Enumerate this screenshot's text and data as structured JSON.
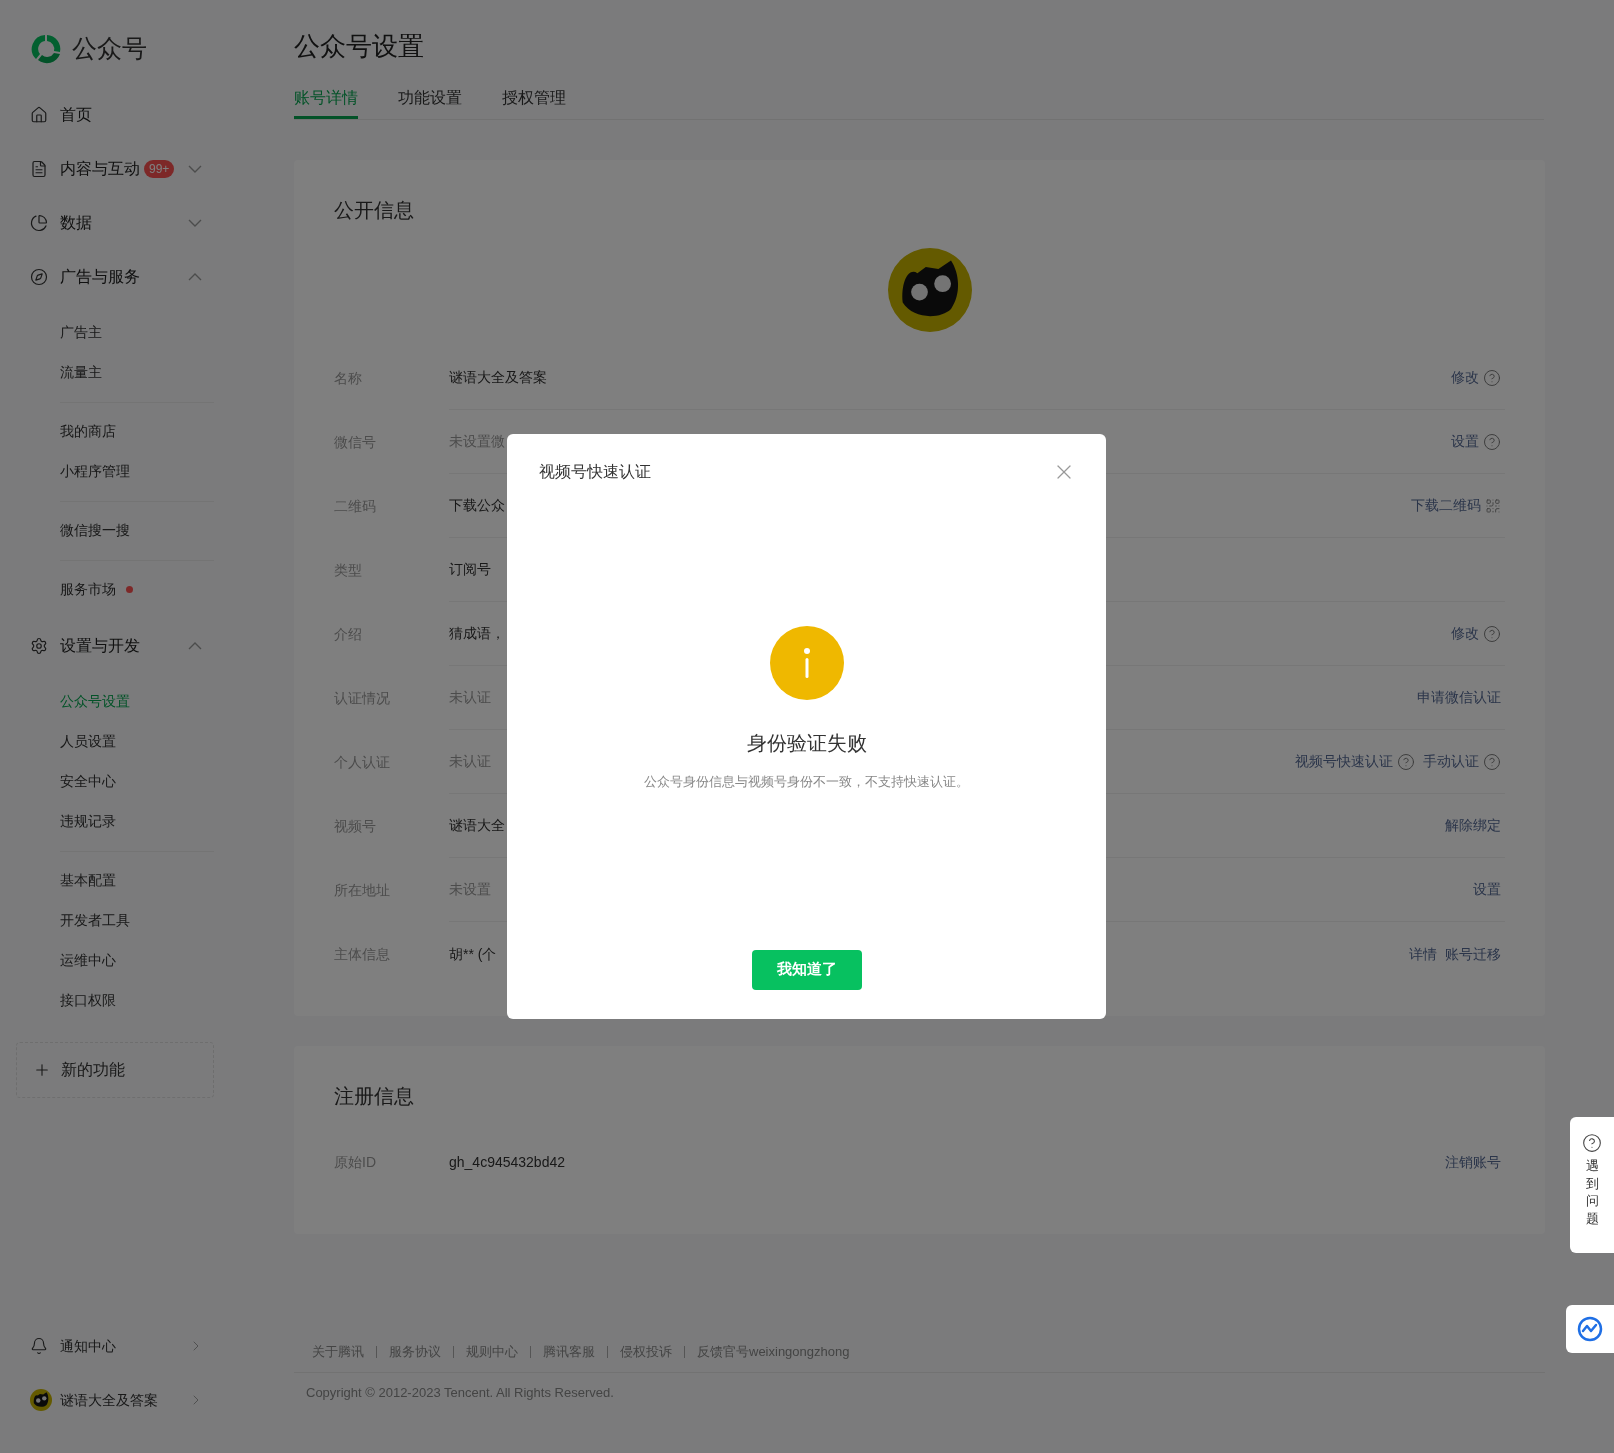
{
  "sidebar": {
    "brand": "公众号",
    "sections": [
      {
        "label": "首页"
      },
      {
        "label": "内容与互动",
        "badge": "99+",
        "expanded": false
      },
      {
        "label": "数据",
        "expanded": false
      },
      {
        "label": "广告与服务",
        "expanded": true,
        "groups": [
          [
            {
              "label": "广告主",
              "selected": false,
              "dot": false
            },
            {
              "label": "流量主",
              "selected": false,
              "dot": false
            }
          ],
          [
            {
              "label": "我的商店",
              "selected": false,
              "dot": false
            },
            {
              "label": "小程序管理",
              "selected": false,
              "dot": false
            }
          ],
          [
            {
              "label": "微信搜一搜",
              "selected": false,
              "dot": false
            }
          ],
          [
            {
              "label": "服务市场",
              "selected": false,
              "dot": true
            }
          ]
        ]
      },
      {
        "label": "设置与开发",
        "expanded": true,
        "groups": [
          [
            {
              "label": "公众号设置",
              "selected": true,
              "dot": false
            },
            {
              "label": "人员设置",
              "selected": false,
              "dot": false
            },
            {
              "label": "安全中心",
              "selected": false,
              "dot": false
            },
            {
              "label": "违规记录",
              "selected": false,
              "dot": false
            }
          ],
          [
            {
              "label": "基本配置",
              "selected": false,
              "dot": false
            },
            {
              "label": "开发者工具",
              "selected": false,
              "dot": false
            },
            {
              "label": "运维中心",
              "selected": false,
              "dot": false
            },
            {
              "label": "接口权限",
              "selected": false,
              "dot": false
            }
          ]
        ]
      }
    ],
    "new_feature": "新的功能",
    "notifications": "通知中心",
    "account": "谜语大全及答案"
  },
  "page": {
    "title": "公众号设置",
    "tabs": [
      {
        "label": "账号详情",
        "selected": true
      },
      {
        "label": "功能设置",
        "selected": false
      },
      {
        "label": "授权管理",
        "selected": false
      }
    ]
  },
  "public_info": {
    "title": "公开信息",
    "rows": [
      {
        "label": "名称",
        "value": "谜语大全及答案",
        "muted": false,
        "actions": [
          {
            "label": "修改",
            "kind": "help"
          }
        ]
      },
      {
        "label": "微信号",
        "value": "未设置微",
        "muted": true,
        "actions": [
          {
            "label": "设置",
            "kind": "help"
          }
        ]
      },
      {
        "label": "二维码",
        "value": "下载公众",
        "muted": false,
        "actions": [
          {
            "label": "下载二维码",
            "kind": "qr"
          }
        ]
      },
      {
        "label": "类型",
        "value": "订阅号",
        "muted": false,
        "actions": []
      },
      {
        "label": "介绍",
        "value": "猜成语，",
        "muted": false,
        "actions": [
          {
            "label": "修改",
            "kind": "help"
          }
        ]
      },
      {
        "label": "认证情况",
        "value": "未认证",
        "muted": true,
        "actions": [
          {
            "label": "申请微信认证",
            "kind": "plain"
          }
        ]
      },
      {
        "label": "个人认证",
        "value": "未认证",
        "muted": true,
        "actions": [
          {
            "label": "视频号快速认证",
            "kind": "help"
          },
          {
            "label": "手动认证",
            "kind": "help"
          }
        ]
      },
      {
        "label": "视频号",
        "value": "谜语大全",
        "muted": false,
        "actions": [
          {
            "label": "解除绑定",
            "kind": "plain"
          }
        ]
      },
      {
        "label": "所在地址",
        "value": "未设置",
        "muted": true,
        "actions": [
          {
            "label": "设置",
            "kind": "plain"
          }
        ]
      },
      {
        "label": "主体信息",
        "value": "胡** (个",
        "muted": false,
        "actions": [
          {
            "label": "详情",
            "kind": "plain"
          },
          {
            "label": "账号迁移",
            "kind": "plain"
          }
        ]
      }
    ]
  },
  "registration": {
    "title": "注册信息",
    "rows": [
      {
        "label": "原始ID",
        "value": "gh_4c945432bd42",
        "muted": false,
        "actions": [
          {
            "label": "注销账号",
            "kind": "plain"
          }
        ]
      }
    ]
  },
  "footer": {
    "links": [
      "关于腾讯",
      "服务协议",
      "规则中心",
      "腾讯客服",
      "侵权投诉",
      "反馈官号weixingongzhong"
    ],
    "copyright": "Copyright © 2012-2023 Tencent. All Rights Reserved."
  },
  "help_widget": {
    "label": "遇到问题"
  },
  "dialog": {
    "title": "视频号快速认证",
    "heading": "身份验证失败",
    "message": "公众号身份信息与视频号身份不一致，不支持快速认证。",
    "button": "我知道了"
  }
}
